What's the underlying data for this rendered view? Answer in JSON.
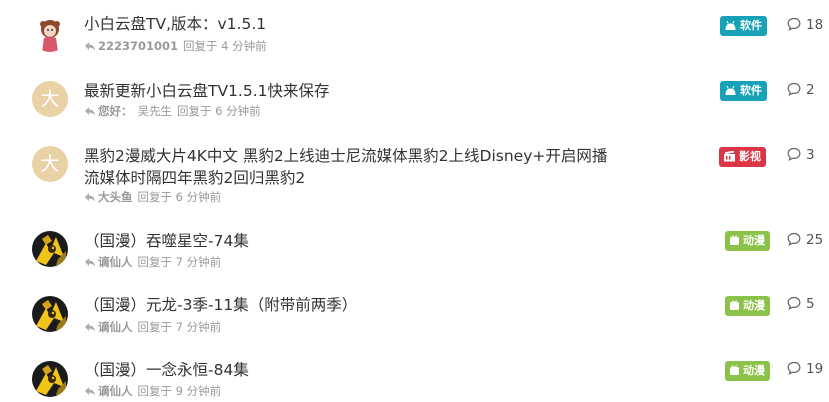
{
  "colors": {
    "software": "#17a2b8",
    "movie": "#dc3545",
    "anime": "#8bc34a",
    "meta": "#999999",
    "title": "#333333"
  },
  "threads": [
    {
      "avatar": "doll-avatar",
      "title": "小白云盘TV,版本：v1.5.1",
      "user": "2223701001",
      "reply_text": "回复于 4 分钟前",
      "badge": "软件",
      "badge_icon": "android-icon",
      "count": "18"
    },
    {
      "avatar": "letter-avatar",
      "avatar_letter": "大",
      "title": "最新更新小白云盘TV1.5.1快来保存",
      "user": "您好：",
      "user_suffix": "吴先生",
      "reply_text": "回复于 6 分钟前",
      "badge": "软件",
      "badge_icon": "android-icon",
      "count": "2"
    },
    {
      "avatar": "letter-avatar",
      "avatar_letter": "大",
      "title_line1": "黑豹2漫威大片4K中文 黑豹2上线迪士尼流媒体黑豹2上线Disney+开启网播",
      "title_line2": "流媒体时隔四年黑豹2回归黑豹2",
      "user": "大头鱼",
      "reply_text": "回复于 6 分钟前",
      "badge": "影视",
      "badge_icon": "film-icon",
      "count": "3"
    },
    {
      "avatar": "monkey-avatar",
      "title": "（国漫）吞噬星空-74集",
      "user": "谪仙人",
      "reply_text": "回复于 7 分钟前",
      "badge": "动漫",
      "badge_icon": "tv-icon",
      "count": "25"
    },
    {
      "avatar": "monkey-avatar",
      "title": "（国漫）元龙-3季-11集（附带前两季）",
      "user": "谪仙人",
      "reply_text": "回复于 7 分钟前",
      "badge": "动漫",
      "badge_icon": "tv-icon",
      "count": "5"
    },
    {
      "avatar": "monkey-avatar",
      "title": "（国漫）一念永恒-84集",
      "user": "谪仙人",
      "reply_text": "回复于 9 分钟前",
      "badge": "动漫",
      "badge_icon": "tv-icon",
      "count": "19"
    }
  ]
}
